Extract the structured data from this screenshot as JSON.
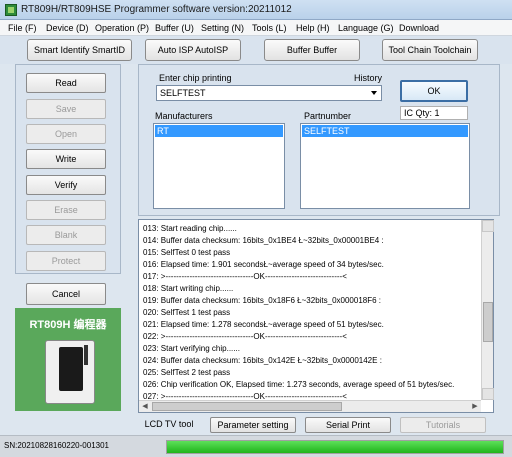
{
  "window": {
    "title": "RT809H/RT809HSE Programmer software version:20211012"
  },
  "menu": [
    "File (F)",
    "Device (D)",
    "Operation (P)",
    "Buffer (U)",
    "Setting (N)",
    "Tools (L)",
    "Help (H)",
    "Language (G)",
    "Download"
  ],
  "toolbar": {
    "smart_identify": "Smart Identify SmartID",
    "auto_isp": "Auto ISP AutoISP",
    "buffer": "Buffer Buffer",
    "toolchain": "Tool Chain Toolchain"
  },
  "operations": [
    {
      "label": "Read",
      "enabled": true
    },
    {
      "label": "Save",
      "enabled": false
    },
    {
      "label": "Open",
      "enabled": false
    },
    {
      "label": "Write",
      "enabled": true
    },
    {
      "label": "Verify",
      "enabled": true
    },
    {
      "label": "Erase",
      "enabled": false
    },
    {
      "label": "Blank",
      "enabled": false
    },
    {
      "label": "Protect",
      "enabled": false
    }
  ],
  "cancel_label": "Cancel",
  "device_image": {
    "brand": "RT809H 编程器"
  },
  "chip": {
    "enter_label": "Enter chip printing",
    "history_label": "History",
    "value": "SELFTEST",
    "ok_label": "OK",
    "ic_qty": "IC Qty: 1",
    "manufacturers_label": "Manufacturers",
    "partnumber_label": "Partnumber",
    "manufacturer_selected": "RT",
    "partnumber_selected": "SELFTEST"
  },
  "log": [
    "013:  Start reading chip......",
    "014:  Buffer data checksum: 16bits_0x1BE4 Ł~32bits_0x00001BE4 :",
    "015:  SelfTest 0 test pass",
    "016:  Elapsed time: 1.901 secondsŁ~average speed of 34 bytes/sec.",
    "017:  >---------------------------------OK-----------------------------<",
    "018:  Start writing chip......",
    "019:  Buffer data checksum: 16bits_0x18F6 Ł~32bits_0x000018F6 :",
    "020:  SelfTest 1 test pass",
    "021:  Elapsed time: 1.278 secondsŁ~average speed of 51 bytes/sec.",
    "022:  >---------------------------------OK-----------------------------<",
    "023:  Start verifying chip......",
    "024:  Buffer data checksum: 16bits_0x142E Ł~32bits_0x0000142E :",
    "025:  SelfTest 2 test pass",
    "026:  Chip verification OK, Elapsed time: 1.273 seconds, average speed of 51 bytes/sec.",
    "027:  >---------------------------------OK-----------------------------<"
  ],
  "bottom_tabs": {
    "lcd": "LCD TV tool",
    "param": "Parameter setting",
    "serial": "Serial Print",
    "tutorials": "Tutorials"
  },
  "status": {
    "sn": "SN:20210828160220-001301",
    "progress_percent": 100,
    "progress_color": "#22c01e"
  }
}
